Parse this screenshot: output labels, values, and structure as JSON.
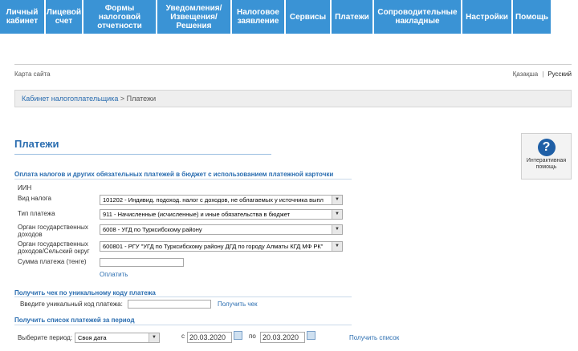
{
  "nav": [
    {
      "label": "Личный\nкабинет",
      "w": 55
    },
    {
      "label": "Лицевой\nсчет",
      "w": 45
    },
    {
      "label": "Формы\nналоговой\nотчетности",
      "w": 90
    },
    {
      "label": "Уведомления/\nИзвещения/\nРешения",
      "w": 91
    },
    {
      "label": "Налоговое\nзаявление",
      "w": 65
    },
    {
      "label": "Сервисы",
      "w": 55
    },
    {
      "label": "Платежи",
      "w": 51
    },
    {
      "label": "Сопроводительные\nнакладные",
      "w": 108
    },
    {
      "label": "Настройки",
      "w": 61
    },
    {
      "label": "Помощь",
      "w": 47
    }
  ],
  "top": {
    "sitemap": "Карта сайта",
    "lang_kz": "Қазақша",
    "lang_sep": "|",
    "lang_ru": "Русский"
  },
  "breadcrumb": {
    "home": "Кабинет налогоплательщика",
    "sep": " > ",
    "current": "Платежи"
  },
  "page_title": "Платежи",
  "help": {
    "icon": "?",
    "label": "Интерактивная помощь"
  },
  "section1": {
    "title": "Оплата налогов и других обязательных платежей в бюджет с использованием платежной карточки",
    "iin_label": "ИИН",
    "tax_label": "Вид налога",
    "tax_value": "101202 - Индивид. подоход. налог с доходов, не облагаемых у источника выпл",
    "paytype_label": "Тип платежа",
    "paytype_value": "911 - Начисленные (исчисленные) и иные обязательства в бюджет",
    "org_label": "Орган государственных доходов",
    "org_value": "6008 - УГД по Турксибскому району",
    "org2_label": "Орган государственных доходов/Сельский округ",
    "org2_value": "600801 - РГУ \"УГД по Турксибскому району ДГД по городу Алматы КГД МФ РК\"",
    "sum_label": "Сумма платежа (тенге)",
    "sum_value": "",
    "pay_link": "Оплатить"
  },
  "section2": {
    "title": "Получить чек по уникальному коду платежа",
    "code_label": "Введите уникальный код платежа:",
    "code_value": "",
    "get_link": "Получить чек"
  },
  "section3": {
    "title": "Получить список платежей за период",
    "period_label": "Выберите период:",
    "period_value": "Своя дата",
    "from_label": "с",
    "from_value": "20.03.2020",
    "to_label": "по",
    "to_value": "20.03.2020",
    "get_link": "Получить список"
  }
}
